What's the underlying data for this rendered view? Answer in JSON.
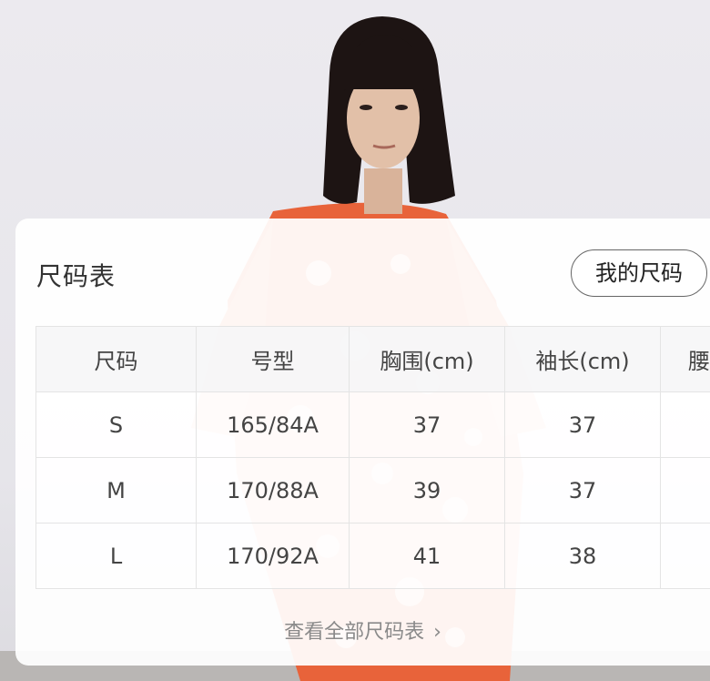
{
  "size_chart": {
    "title": "尺码表",
    "my_size_button": "我的尺码",
    "columns": [
      "尺码",
      "号型",
      "胸围(cm)",
      "袖长(cm)",
      "腰"
    ],
    "rows": [
      {
        "size": "S",
        "type": "165/84A",
        "bust": "37",
        "sleeve": "37",
        "waist": ""
      },
      {
        "size": "M",
        "type": "170/88A",
        "bust": "39",
        "sleeve": "37",
        "waist": ""
      },
      {
        "size": "L",
        "type": "170/92A",
        "bust": "41",
        "sleeve": "38",
        "waist": ""
      }
    ],
    "view_all_link": "查看全部尺码表",
    "view_all_chevron": "›"
  },
  "icons": {
    "chevron": "chevron-right-icon"
  },
  "colors": {
    "card_background": "#ffffff",
    "header_background": "#f6f6f7",
    "border": "#e4e4e4",
    "link_gray": "#8a8a8a",
    "dress_orange": "#e8633a"
  }
}
